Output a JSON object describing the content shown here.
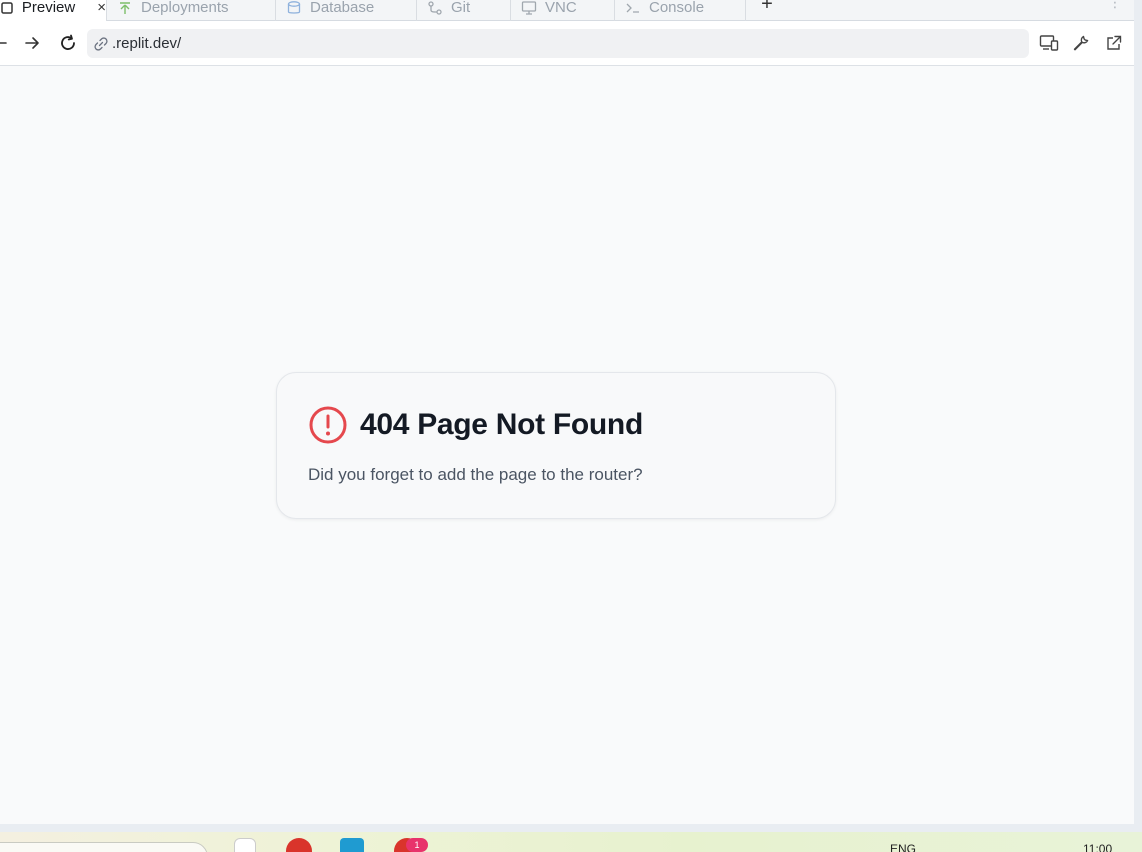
{
  "tabs": [
    {
      "label": "Preview",
      "icon": "preview-icon",
      "active": true
    },
    {
      "label": "Deployments",
      "icon": "deployments-icon",
      "active": false
    },
    {
      "label": "Database",
      "icon": "database-icon",
      "active": false
    },
    {
      "label": "Git",
      "icon": "git-icon",
      "active": false
    },
    {
      "label": "VNC",
      "icon": "monitor-icon",
      "active": false
    },
    {
      "label": "Console",
      "icon": "terminal-icon",
      "active": false
    }
  ],
  "tab_close_glyph": "×",
  "add_tab_glyph": "+",
  "addressbar": {
    "url": ".replit.dev/"
  },
  "page": {
    "title": "404 Page Not Found",
    "message": "Did you forget to add the page to the router?"
  },
  "taskbar": {
    "language": "ENG",
    "time": "11:00",
    "badge_count": "1"
  },
  "colors": {
    "error_red": "#e5484d",
    "title_text": "#141a24",
    "body_text": "#4b5563",
    "deployments_green": "#7dbf6a",
    "database_blue": "#8fb2dd"
  }
}
